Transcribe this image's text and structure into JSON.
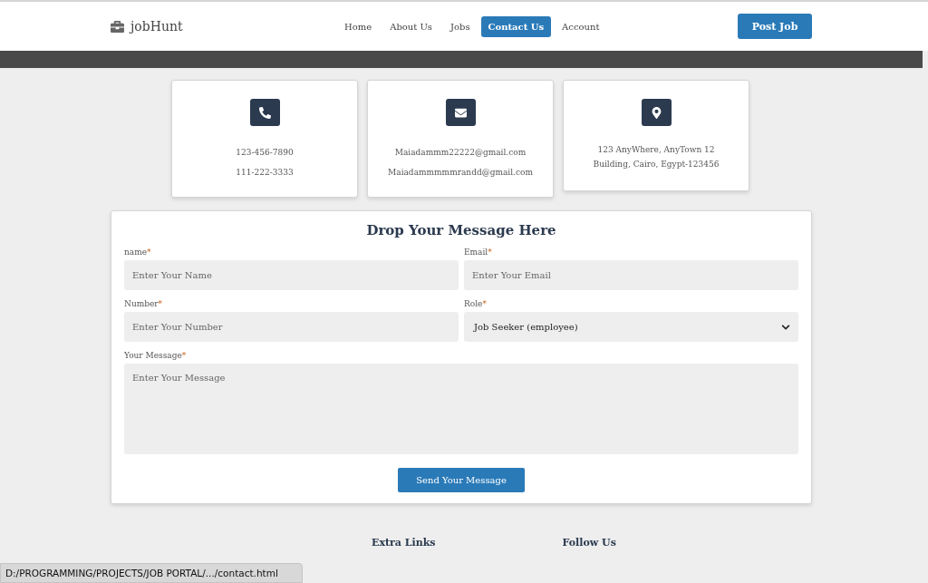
{
  "brand": {
    "name": "jobHunt"
  },
  "nav": [
    {
      "label": "Home",
      "selected": false
    },
    {
      "label": "About Us",
      "selected": false
    },
    {
      "label": "Jobs",
      "selected": false
    },
    {
      "label": "Contact Us",
      "selected": true
    },
    {
      "label": "Account",
      "selected": false
    }
  ],
  "post_button": "Post Job",
  "contact_cards": [
    {
      "kind": "phone",
      "lines": [
        "123-456-7890",
        "111-222-3333"
      ]
    },
    {
      "kind": "email",
      "lines": [
        "Maiadammm22222@gmail.com",
        "Maiadammmmmrandd@gmail.com"
      ]
    },
    {
      "kind": "location",
      "lines": [
        "123 AnyWhere, AnyTown 12",
        "Building, Cairo, Egypt-123456"
      ]
    }
  ],
  "form": {
    "title": "Drop Your Message Here",
    "fields": [
      {
        "kind": "input",
        "label": "name",
        "required_mark": "*",
        "placeholder": "Enter Your Name"
      },
      {
        "kind": "input",
        "label": "Email",
        "required_mark": "*",
        "placeholder": "Enter Your Email"
      },
      {
        "kind": "input",
        "label": "Number",
        "required_mark": "*",
        "placeholder": "Enter Your Number"
      },
      {
        "kind": "select",
        "label": "Role",
        "required_mark": "*",
        "value": "Job Seeker (employee)"
      }
    ],
    "message": {
      "label": "Your Message",
      "required_mark": "*",
      "placeholder": "Enter Your Message"
    },
    "submit": "Send Your Message"
  },
  "footer_headings": [
    "Extra Links",
    "Follow Us"
  ],
  "status_bar": "D:/PROGRAMMING/PROJECTS/JOB PORTAL/.../contact.html"
}
